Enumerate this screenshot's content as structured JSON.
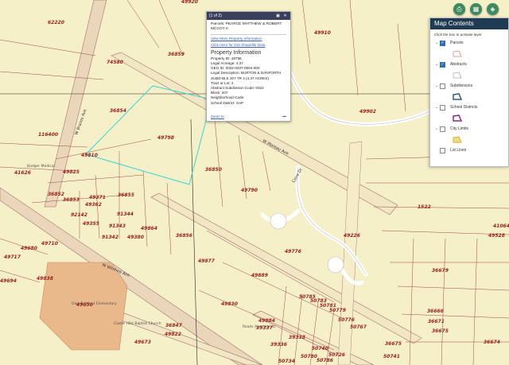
{
  "popup": {
    "page": "(1 of 2)",
    "title": "Parcels: PEARCE MATTHEW & ROBERT MCCOY II",
    "link_report": "View More Property Information",
    "link_shapefile": "Click Here for GIS Shapefile Data",
    "section": "Property Information",
    "fields": [
      "Property ID: 49798",
      "Legal Acreage: 4.37",
      "GEO ID: 0022-0207-0004-000",
      "Legal Description: BURTON & DANFORTH",
      "SUBD BLK 207 TR 4 (4.37 ACRES)",
      "Tract or Lot: 4",
      "Abstract Subdivision Code: 0022",
      "Block: 207",
      "Neighborhood Code:",
      "School District: SAP"
    ],
    "zoom_to": "Zoom to",
    "more": "•••"
  },
  "panel": {
    "title": "Map Contents",
    "hint": "Click the box to activate layer",
    "layers": [
      {
        "name": "Parcels",
        "checked": true,
        "swatch_color": "#d9a0a0"
      },
      {
        "name": "Abstracts",
        "checked": true,
        "swatch_color": "#bdbdbd"
      },
      {
        "name": "Subdivisions",
        "checked": false,
        "swatch_color": "#2e5c8a"
      },
      {
        "name": "School Districts",
        "checked": false,
        "swatch_color": "#8a2a8a"
      },
      {
        "name": "City Limits",
        "checked": false,
        "swatch_color": "#d8b020"
      },
      {
        "name": "Lot Lines",
        "checked": false,
        "swatch_color": ""
      }
    ]
  },
  "buttons": [
    "print-icon",
    "basemap-grid-icon",
    "layers-icon"
  ],
  "streets": {
    "w_brazos": "W Brazos Ave",
    "w_wilshire": "W Wilshire Ave",
    "w_moreau": "W Moreau Ave",
    "cove_dr": "Cove Dr"
  },
  "places": {
    "badger": "Badger Medical",
    "school": "Dale Fairland Elementary",
    "castle": "Castle Hills Baptist Church",
    "roads": "Roads Apartments"
  },
  "parcels": [
    "62220",
    "49920",
    "49910",
    "74580",
    "36859",
    "36854",
    "49798",
    "49902",
    "116400",
    "49810",
    "41626",
    "49825",
    "36852",
    "36853",
    "49371",
    "49362",
    "92142",
    "49355",
    "36855",
    "91344",
    "91343",
    "91342",
    "36850",
    "49790",
    "49380",
    "36856",
    "49864",
    "49877",
    "49680",
    "49710",
    "49717",
    "49694",
    "49838",
    "49650",
    "49889",
    "49830",
    "49776",
    "49226",
    "41064",
    "49884",
    "49673",
    "36847",
    "49822",
    "50785",
    "50783",
    "50781",
    "50779",
    "50776",
    "50767",
    "39337",
    "39338",
    "50740",
    "39336",
    "50780",
    "50786",
    "50734",
    "50726",
    "36675",
    "50741",
    "36666",
    "36671",
    "36679",
    "36675",
    "36674",
    "49528",
    "1522"
  ]
}
